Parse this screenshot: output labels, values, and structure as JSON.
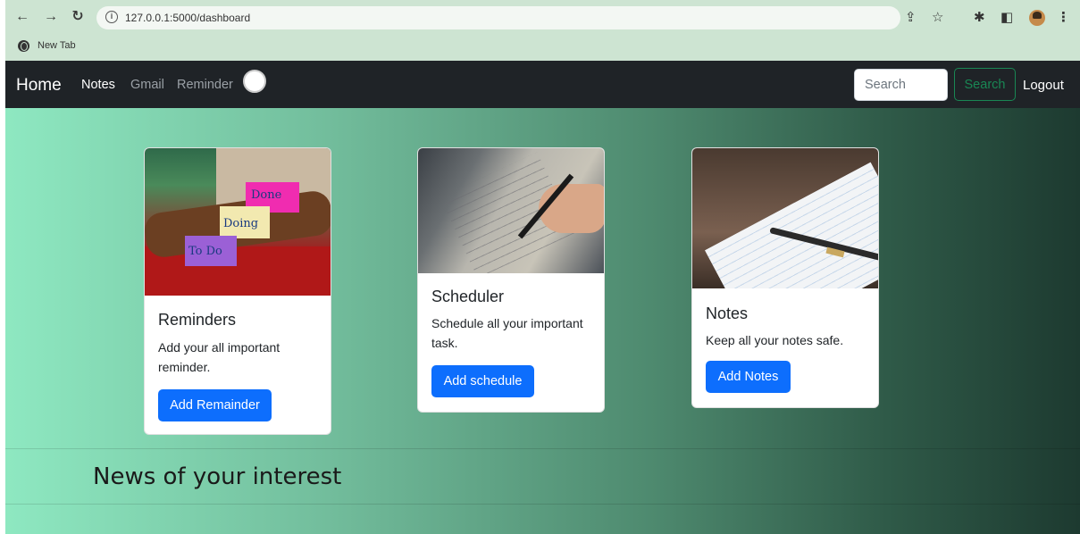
{
  "browser": {
    "url": "127.0.0.1:5000/dashboard",
    "bookmark_label": "New Tab",
    "icons": [
      "back-icon",
      "forward-icon",
      "reload-icon",
      "info-icon",
      "share-icon",
      "star-icon",
      "extensions-icon",
      "sidepanel-icon",
      "profile-avatar",
      "menu-icon"
    ]
  },
  "navbar": {
    "brand": "Home",
    "links": [
      {
        "label": "Notes",
        "state": "active"
      },
      {
        "label": "Gmail",
        "state": "muted"
      },
      {
        "label": "Reminder",
        "state": "muted"
      }
    ],
    "search_placeholder": "Search",
    "search_button": "Search",
    "logout": "Logout"
  },
  "cards": [
    {
      "title": "Reminders",
      "text": "Add your all important reminder.",
      "button": "Add Remainder",
      "image": "sticky-notes-image",
      "image_notes": [
        "Done",
        "Doing",
        "To Do"
      ]
    },
    {
      "title": "Scheduler",
      "text": "Schedule all your important task.",
      "button": "Add schedule",
      "image": "notebook-writing-image"
    },
    {
      "title": "Notes",
      "text": "Keep all your notes safe.",
      "button": "Add Notes",
      "image": "notebook-pen-image"
    }
  ],
  "news_heading": "News of your interest",
  "colors": {
    "navbar_bg": "#1f2327",
    "primary_button": "#0d6efd",
    "search_button": "#198754",
    "gradient_start": "#8ee8c1",
    "gradient_end": "#1d3a30"
  }
}
